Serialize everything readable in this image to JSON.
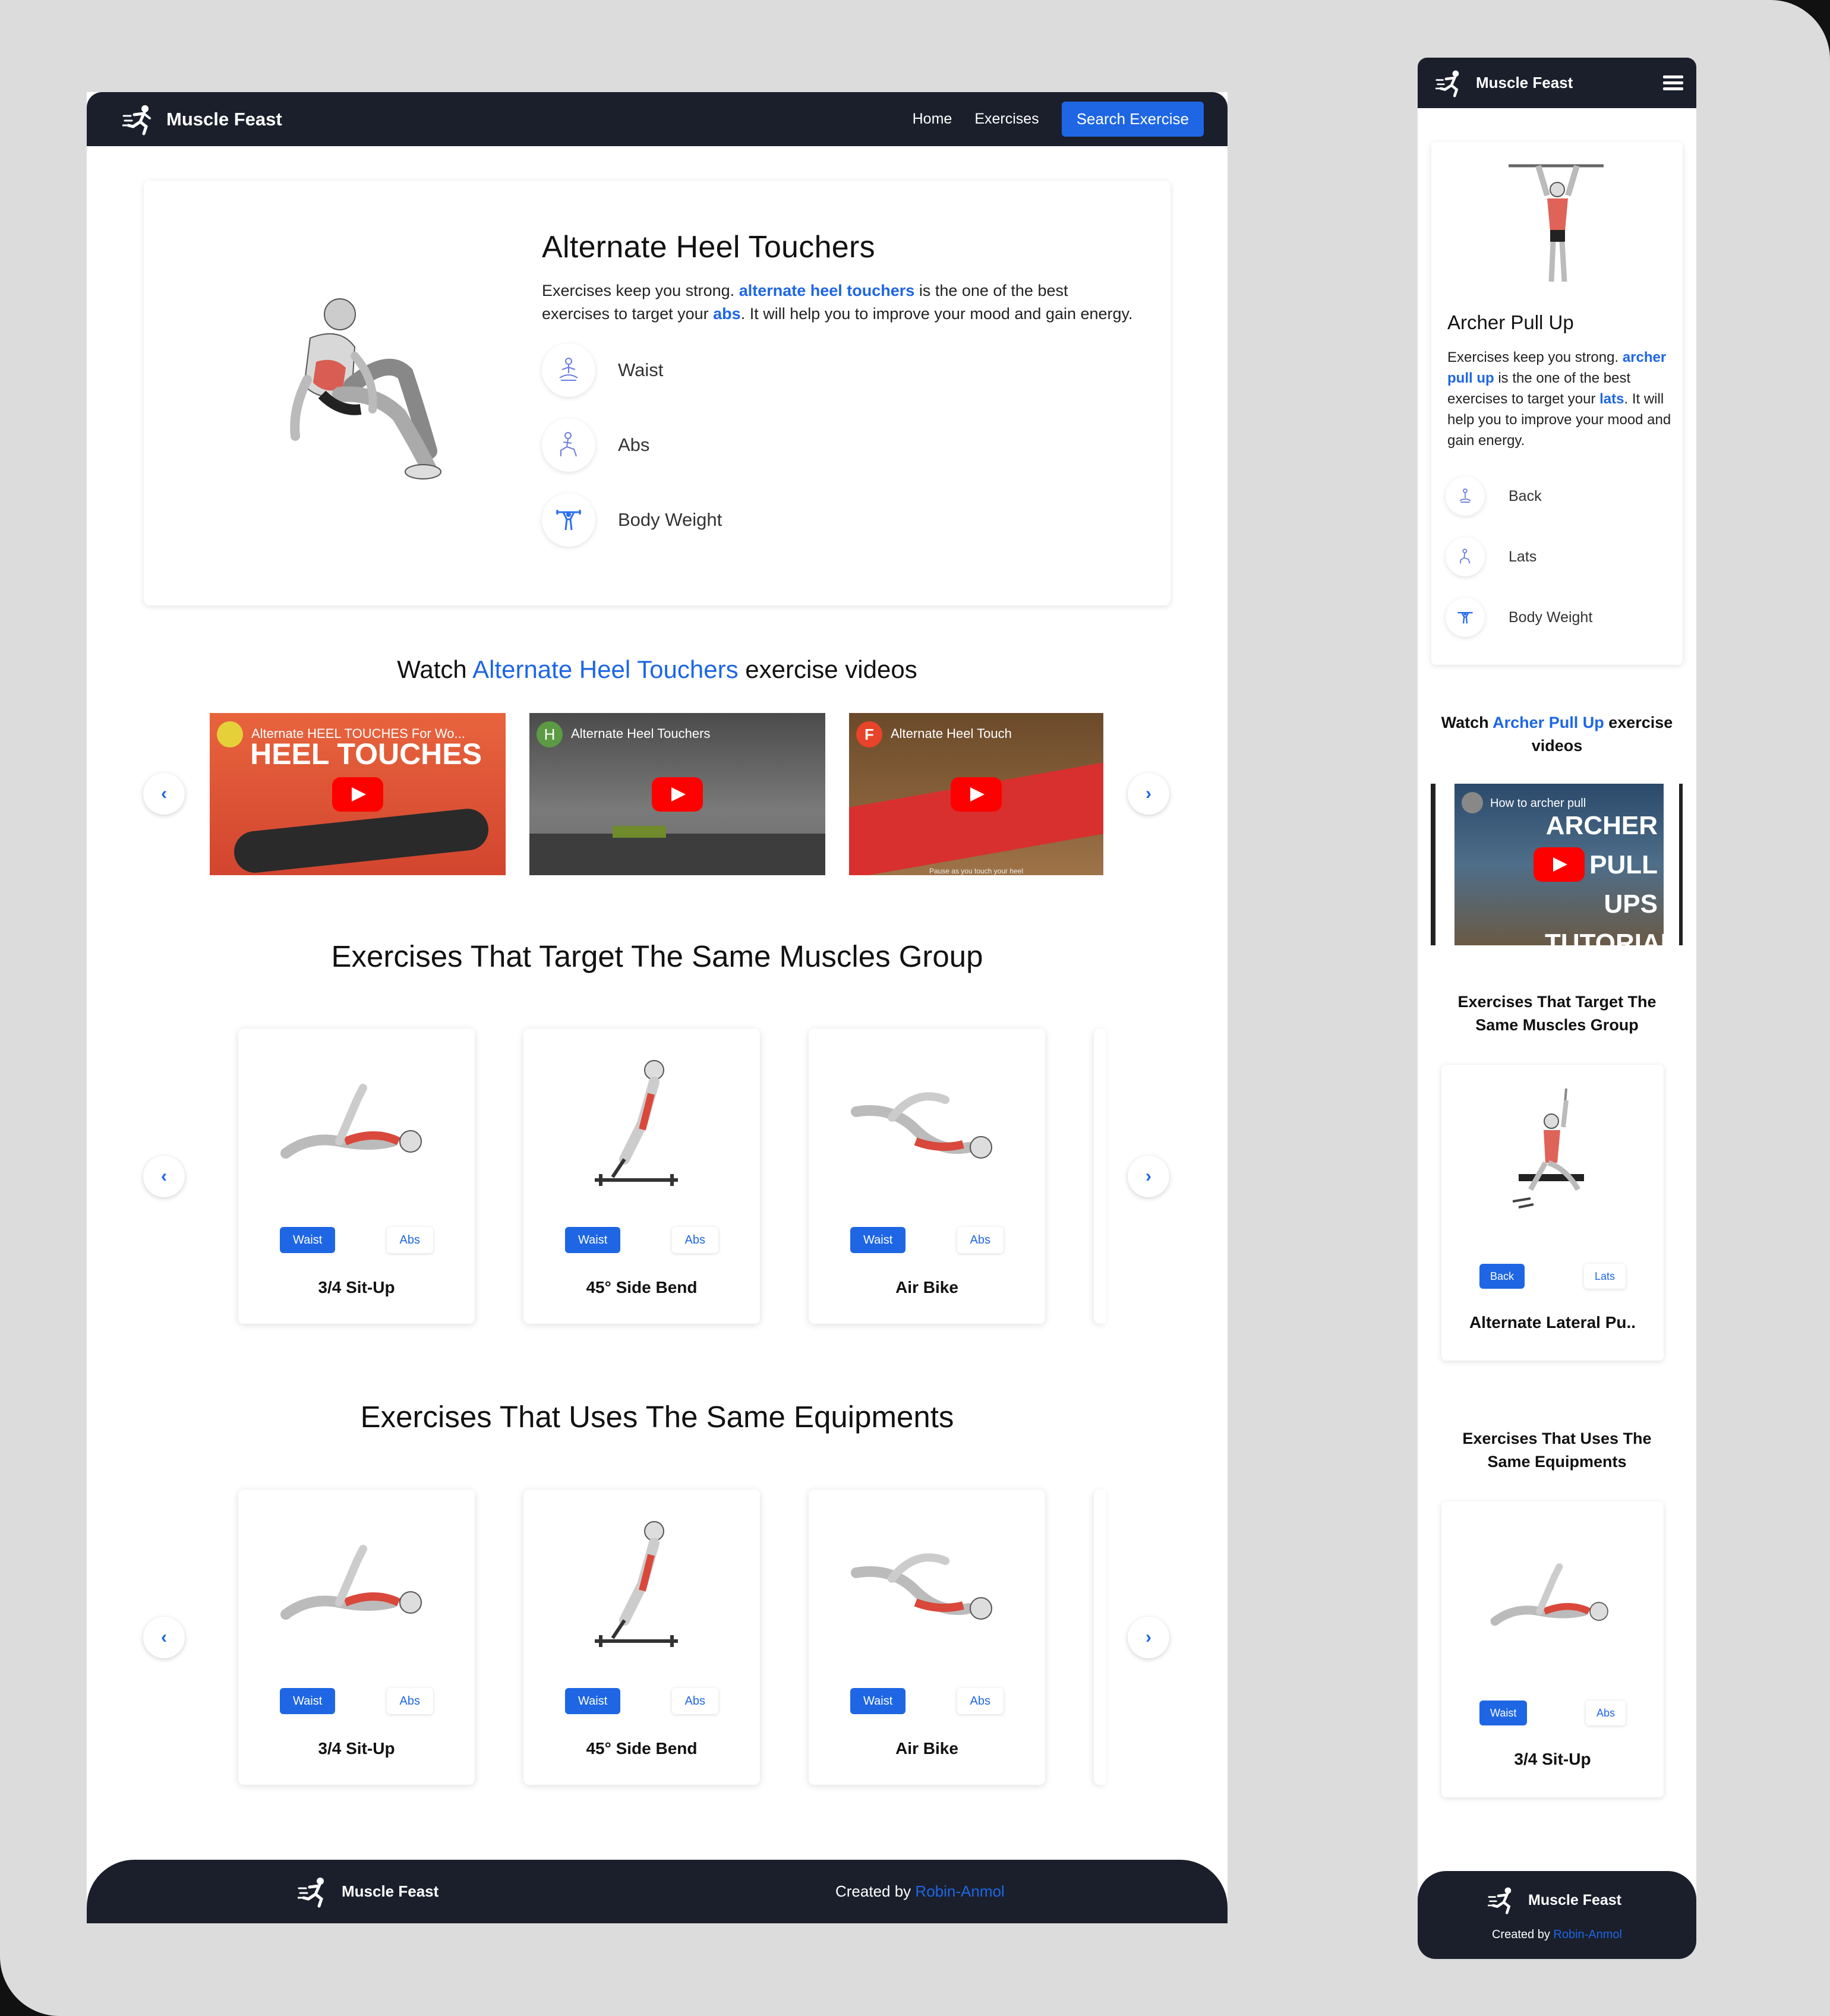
{
  "brand": {
    "name": "Muscle Feast"
  },
  "nav": {
    "home": "Home",
    "exercises": "Exercises",
    "search": "Search Exercise"
  },
  "exercise": {
    "title": "Alternate Heel Touchers",
    "desc_prefix": "Exercises keep you strong.",
    "desc_link_name": "alternate heel touchers",
    "desc_mid": "is the one of the best exercises to target your",
    "desc_link_target": "abs",
    "desc_suffix": ". It will help you to improve your mood and gain energy.",
    "tags": [
      {
        "label": "Waist",
        "icon": "meditation-icon"
      },
      {
        "label": "Abs",
        "icon": "lunge-icon"
      },
      {
        "label": "Body Weight",
        "icon": "weightlifter-icon"
      }
    ]
  },
  "videos": {
    "heading_prefix": "Watch",
    "heading_name": "Alternate Heel Touchers",
    "heading_suffix": "exercise videos",
    "items": [
      {
        "title": "Alternate HEEL TOUCHES For Wo...",
        "overlay": "HEEL TOUCHES"
      },
      {
        "title": "Alternate Heel Touchers",
        "avatar_letter": "H"
      },
      {
        "title": "Alternate Heel Touch",
        "avatar_letter": "F",
        "caption": "Pause as you touch your heel"
      }
    ]
  },
  "same_muscles": {
    "title": "Exercises That Target The Same Muscles Group",
    "cards": [
      {
        "name": "3/4 Sit-Up",
        "tag1": "Waist",
        "tag2": "Abs"
      },
      {
        "name": "45° Side Bend",
        "tag1": "Waist",
        "tag2": "Abs"
      },
      {
        "name": "Air Bike",
        "tag1": "Waist",
        "tag2": "Abs"
      }
    ]
  },
  "same_equipment": {
    "title": "Exercises That Uses The Same Equipments",
    "cards": [
      {
        "name": "3/4 Sit-Up",
        "tag1": "Waist",
        "tag2": "Abs"
      },
      {
        "name": "45° Side Bend",
        "tag1": "Waist",
        "tag2": "Abs"
      },
      {
        "name": "Air Bike",
        "tag1": "Waist",
        "tag2": "Abs"
      }
    ]
  },
  "footer": {
    "credit_prefix": "Created by",
    "author": "Robin-Anmol"
  },
  "mobile": {
    "exercise": {
      "title": "Archer Pull Up",
      "desc_prefix": "Exercises keep you strong.",
      "desc_link_name": "archer pull up",
      "desc_mid": "is the one of the best exercises to target your",
      "desc_link_target": "lats",
      "desc_suffix": ". It will help you to improve your mood and gain energy.",
      "tags": [
        {
          "label": "Back",
          "icon": "meditation-icon"
        },
        {
          "label": "Lats",
          "icon": "lunge-icon"
        },
        {
          "label": "Body Weight",
          "icon": "weightlifter-icon"
        }
      ]
    },
    "videos": {
      "heading_prefix": "Watch",
      "heading_name": "Archer Pull Up",
      "heading_suffix": "exercise videos",
      "item": {
        "title": "How to archer pull",
        "overlay": "ARCHER PULL UPS TUTORIAL"
      }
    },
    "same_muscles": {
      "title": "Exercises That Target The Same Muscles Group",
      "card": {
        "name": "Alternate Lateral Pu..",
        "tag1": "Back",
        "tag2": "Lats"
      }
    },
    "same_equipment": {
      "title": "Exercises That Uses The Same Equipments",
      "card": {
        "name": "3/4 Sit-Up",
        "tag1": "Waist",
        "tag2": "Abs"
      }
    }
  },
  "colors": {
    "accent": "#1e66e4",
    "navbar": "#1a1f2b",
    "muscle": "#d9483b"
  }
}
